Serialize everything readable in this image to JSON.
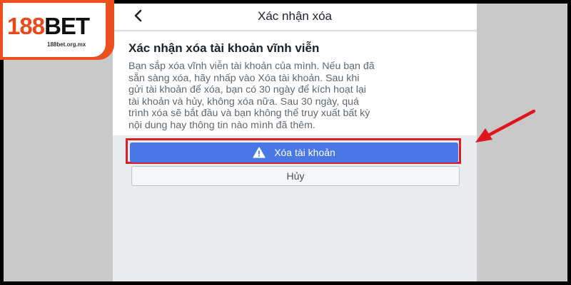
{
  "header": {
    "back_icon": "chevron-left-icon",
    "title": "Xác nhận xóa"
  },
  "card": {
    "title": "Xác nhận xóa tài khoản vĩnh viễn",
    "lines": [
      "Bạn sắp xóa vĩnh viễn tài khoản của mình. Nếu bạn đã",
      "sẵn sàng xóa, hãy nhấp vào Xóa tài khoản. Sau khi",
      "gửi tài khoản để xóa, bạn có 30 ngày để kích hoạt lại",
      "tài khoản và hủy, không xóa nữa. Sau 30 ngày, quá",
      "trình xóa sẽ bắt đầu và bạn không thể truy xuất bất kỳ",
      "nội dung hay thông tin nào mình đã thêm."
    ]
  },
  "actions": {
    "delete_label": "Xóa tài khoản",
    "delete_icon": "warning-icon",
    "cancel_label": "Hủy"
  },
  "watermark": {
    "brand_num": "188",
    "brand_word": "BET",
    "domain": "188bet.org.mx"
  },
  "annotation": {
    "arrow_icon": "red-arrow-icon"
  },
  "colors": {
    "primary_button": "#4a77e6",
    "highlight": "#d8202b",
    "brand_orange": "#ec4e1e"
  }
}
